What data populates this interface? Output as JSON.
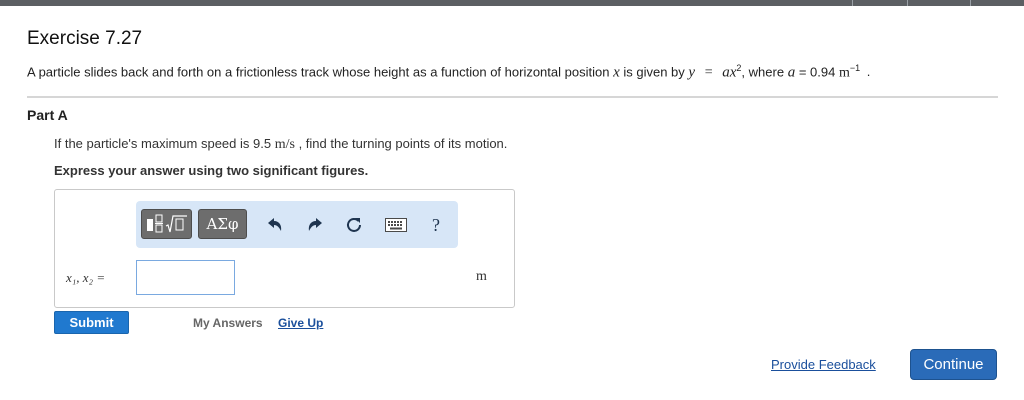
{
  "header": {
    "title": "Exercise 7.27"
  },
  "problem": {
    "text_before": "A particle slides back and forth on a frictionless track whose height as a function of horizontal position",
    "var_x": "x",
    "text_middle": "is given by",
    "var_y": "y",
    "equals": "=",
    "rhs_a": "a",
    "rhs_x": "x",
    "exponent_2": "2",
    "text_where": ", where",
    "var_a": "a",
    "a_value": "= 0.94",
    "a_unit": "m",
    "a_exponent": "−1",
    "end_period": "."
  },
  "part": {
    "heading": "Part A",
    "question_before": "If the particle's maximum speed is 9.5",
    "speed_unit": "m/s",
    "question_after": ", find the turning points of its motion.",
    "instruction": "Express your answer using two significant figures."
  },
  "toolbar": {
    "greek_label": "ΑΣφ",
    "help_label": "?",
    "icons": [
      "template-icon",
      "sqrt-icon",
      "undo-icon",
      "redo-icon",
      "reset-icon",
      "keyboard-icon",
      "help-icon"
    ]
  },
  "answer": {
    "variable_label": "x₁, x₂ =",
    "value": "",
    "unit": "m"
  },
  "actions": {
    "submit": "Submit",
    "my_answers": "My Answers",
    "give_up": "Give Up",
    "provide_feedback": "Provide Feedback",
    "continue": "Continue"
  },
  "colors": {
    "primary_button": "#2079cf",
    "continue_button": "#2a6bb8",
    "toolbar_bg": "#d7e6f7",
    "link": "#1a4f9c"
  }
}
